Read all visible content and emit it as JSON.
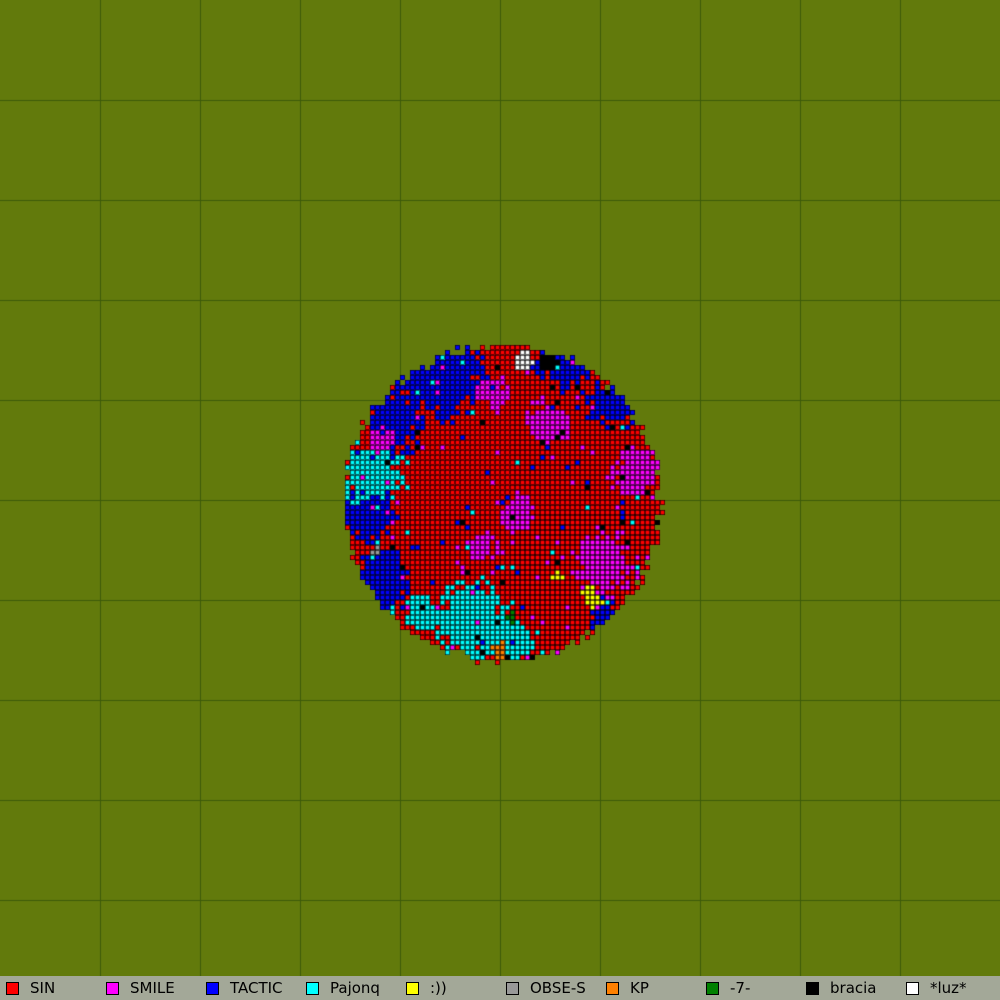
{
  "map": {
    "background_color": "#627a0c",
    "grid_line_color": "#3d5a0a",
    "grid_size": 10,
    "continent": {
      "center": [
        500,
        500
      ],
      "radius": 160,
      "dominant_tribe": "SIN"
    }
  },
  "legend": {
    "background_color": "#a3a898",
    "items": [
      {
        "name": "SIN",
        "color": "#ff0000"
      },
      {
        "name": "SMILE",
        "color": "#ff00ff"
      },
      {
        "name": "TACTIC",
        "color": "#0000ff"
      },
      {
        "name": "Pajonq",
        "color": "#00ffff"
      },
      {
        "name": ":))",
        "color": "#ffff00"
      },
      {
        "name": "OBSE-S",
        "color": "#999999"
      },
      {
        "name": "KP",
        "color": "#ff8000"
      },
      {
        "name": "-7-",
        "color": "#008000"
      },
      {
        "name": "bracia",
        "color": "#000000"
      },
      {
        "name": "*luz*",
        "color": "#ffffff"
      }
    ]
  }
}
